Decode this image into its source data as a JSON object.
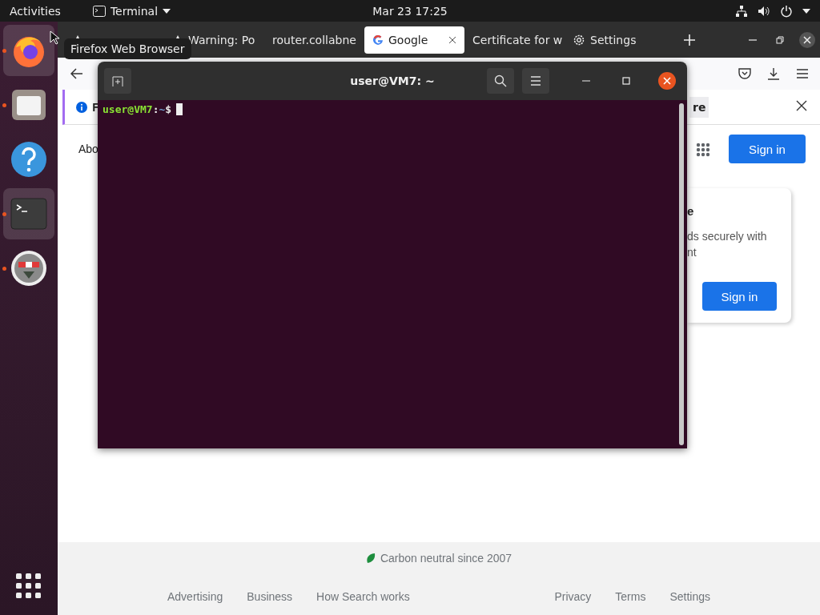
{
  "top_bar": {
    "activities": "Activities",
    "app_menu": "Terminal",
    "clock": "Mar 23  17:25"
  },
  "dock": {
    "apps": [
      {
        "kind": "firefox",
        "running": true,
        "highlighted": true
      },
      {
        "kind": "files",
        "running": true,
        "highlighted": false
      },
      {
        "kind": "help",
        "running": false,
        "highlighted": false
      },
      {
        "kind": "terminal",
        "running": true,
        "highlighted": true
      },
      {
        "kind": "installer",
        "running": true,
        "highlighted": false
      }
    ]
  },
  "tooltip": "Firefox Web Browser",
  "browser": {
    "tabs": [
      {
        "kind": "warning",
        "selected": false
      },
      {
        "kind": "warning",
        "label": "Warning: Po",
        "selected": false
      },
      {
        "kind": "plain",
        "label": "router.collabne",
        "selected": false
      },
      {
        "kind": "google",
        "label": "Google",
        "selected": true
      },
      {
        "kind": "plain",
        "label": "Certificate for w",
        "selected": false
      },
      {
        "kind": "settings",
        "label": "Settings",
        "selected": false
      }
    ],
    "notification": {
      "text": "F",
      "button": "re"
    },
    "page": {
      "header_link": "Abo",
      "sign_in": "Sign in",
      "card": {
        "title": "e",
        "lines": [
          "ds securely with",
          "nt"
        ],
        "button": "Sign in"
      },
      "footer": {
        "carbon": "Carbon neutral since 2007",
        "left_links": [
          "Advertising",
          "Business",
          "How Search works"
        ],
        "right_links": [
          "Privacy",
          "Terms",
          "Settings"
        ]
      }
    }
  },
  "terminal": {
    "title": "user@VM7: ~",
    "prompt": {
      "user": "user@VM7",
      "sep": ":",
      "path": "~",
      "sign": "$"
    }
  }
}
